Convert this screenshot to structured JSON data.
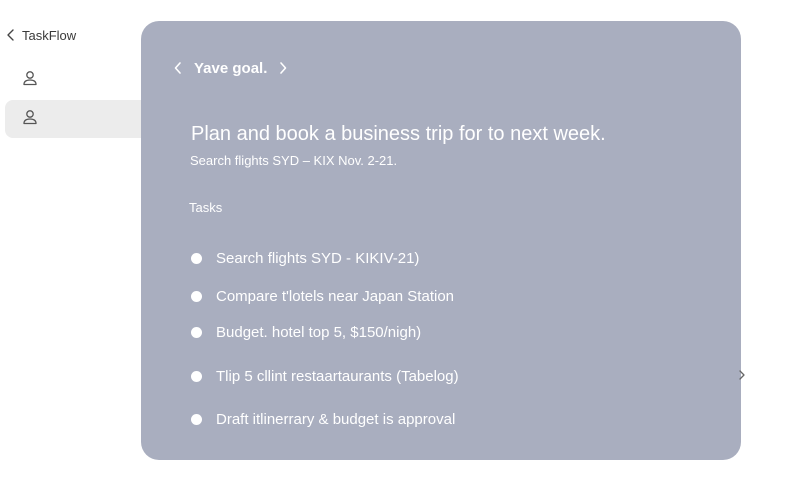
{
  "sidebar": {
    "title": "TaskFlow",
    "back_icon": "chevron-left-icon",
    "items": [
      {
        "icon": "user-icon",
        "selected": false
      },
      {
        "icon": "user-icon",
        "selected": true
      }
    ]
  },
  "card": {
    "nav_title": "Yave goal.",
    "prev_icon": "chevron-left-icon",
    "next_icon": "chevron-right-icon",
    "goal_title": "Plan and book a business trip for to next week.",
    "goal_subtitle": "Search flights SYD – KIX Nov. 2-21.",
    "tasks_label": "Tasks",
    "tasks": [
      {
        "text": "Search flights  SYD - KIKIV-21)"
      },
      {
        "text": "Compare t'lotels near Japan Station"
      },
      {
        "text": "Budget. hotel top 5, $150/nigh)"
      },
      {
        "text": "Tlip 5 cllint restaartaurants (Tabelog)"
      },
      {
        "text": "Draft itlinerrary & budget is approval"
      }
    ]
  },
  "colors": {
    "card_background": "#a9aebf",
    "card_text": "#ffffff",
    "sidebar_selected": "#ececec",
    "sidebar_text": "#3a3a3a"
  }
}
